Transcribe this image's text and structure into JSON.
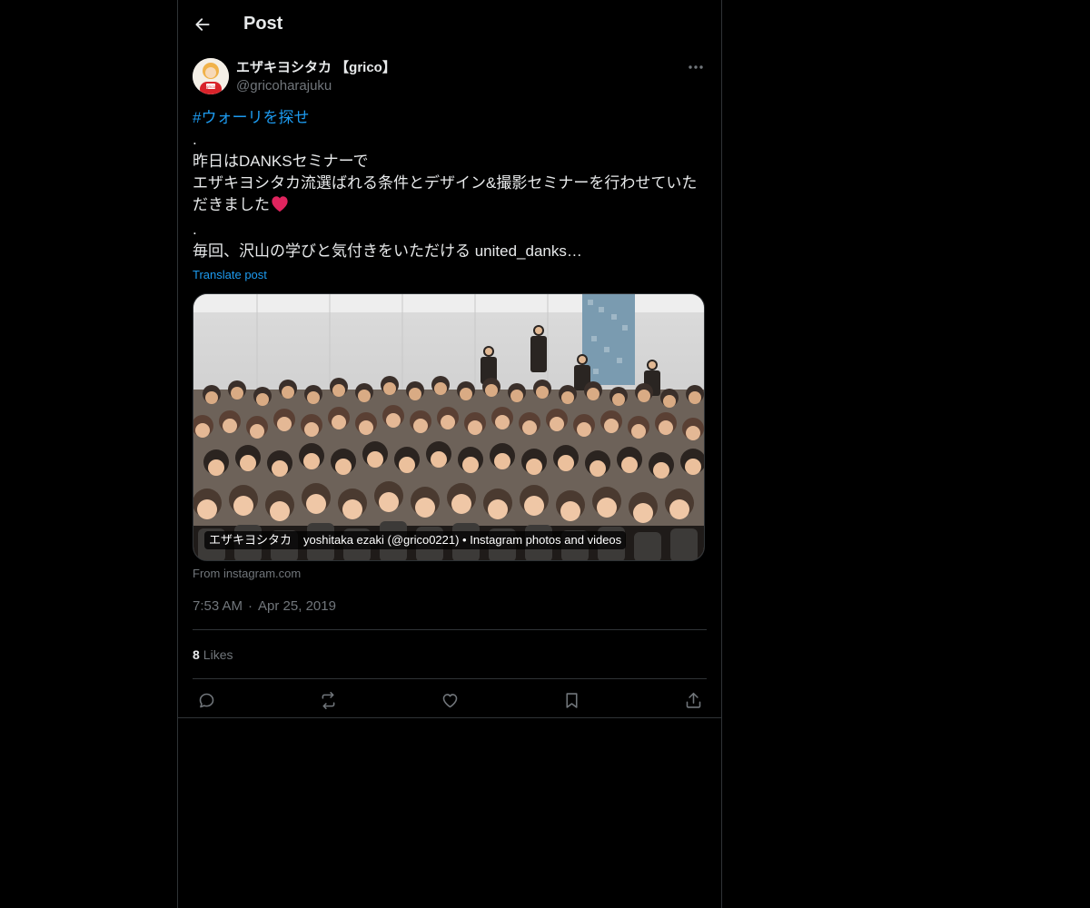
{
  "header": {
    "title": "Post"
  },
  "post": {
    "author": {
      "display_name": "エザキヨシタカ 【grico】",
      "handle": "@gricoharajuku",
      "avatar_text": "grico"
    },
    "hashtag": "#ウォーリを探せ",
    "body_lines": [
      ".",
      "昨日はDANKSセミナーで",
      "エザキヨシタカ流選ばれる条件とデザイン&撮影セミナーを行わせていただきました",
      ".",
      "毎回、沢山の学びと気付きをいただける united_danks…"
    ],
    "translate_label": "Translate post",
    "card": {
      "caption": "エザキヨシタカ　yoshitaka ezaki (@grico0221) • Instagram photos and videos",
      "source": "From instagram.com"
    },
    "time": "7:53 AM",
    "separator": "·",
    "date": "Apr 25, 2019",
    "likes_count": "8",
    "likes_label": "Likes"
  },
  "icons": {
    "back": "arrow-left-icon",
    "more": "more-horizontal-icon",
    "reply": "reply-icon",
    "repost": "repost-icon",
    "like": "heart-icon",
    "bookmark": "bookmark-icon",
    "share": "share-icon"
  },
  "colors": {
    "background": "#000000",
    "link": "#1d9bf0",
    "secondary_text": "#71767b",
    "primary_text": "#e7e9ea",
    "border": "#2f3336",
    "heart_emoji": "#e0245e"
  }
}
